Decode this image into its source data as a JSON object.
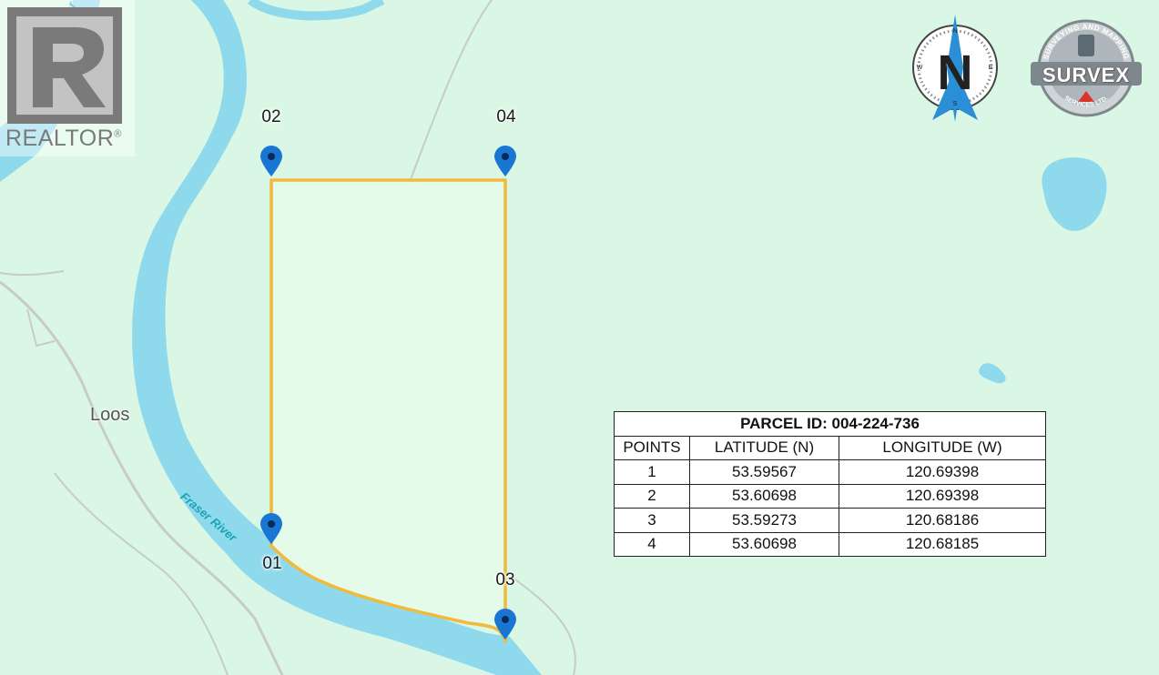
{
  "map": {
    "place_label": "Loos",
    "river_label_top": "Fraser River",
    "river_label_bottom": "Fraser River",
    "colors": {
      "land": "#d9f7e4",
      "water": "#8fd9ec",
      "parcel_fill": "#e4fbea",
      "parcel_border": "#f2b93b",
      "marker": "#1976d2",
      "road": "#c8c8c8"
    },
    "markers": [
      {
        "id": "01",
        "label": "01"
      },
      {
        "id": "02",
        "label": "02"
      },
      {
        "id": "03",
        "label": "03"
      },
      {
        "id": "04",
        "label": "04"
      }
    ]
  },
  "logos": {
    "realtor": {
      "text": "REALTOR",
      "mark": "®"
    },
    "compass": {
      "north": "N",
      "south": "S",
      "east": "E",
      "west": "W"
    },
    "survex": {
      "name": "SURVEX",
      "arc_top": "SURVEYING AND MAPPING",
      "arc_bottom": "SERVICES LTD."
    }
  },
  "table": {
    "title": "PARCEL ID: 004-224-736",
    "headers": [
      "POINTS",
      "LATITUDE (N)",
      "LONGITUDE (W)"
    ],
    "rows": [
      [
        "1",
        "53.59567",
        "120.69398"
      ],
      [
        "2",
        "53.60698",
        "120.69398"
      ],
      [
        "3",
        "53.59273",
        "120.68186"
      ],
      [
        "4",
        "53.60698",
        "120.68185"
      ]
    ]
  }
}
